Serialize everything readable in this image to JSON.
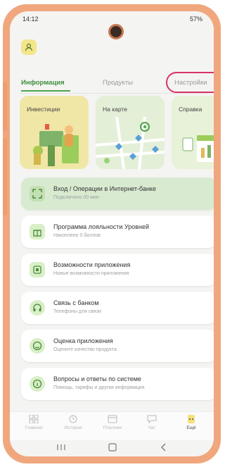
{
  "status_bar": {
    "time": "14:12",
    "right": "57%"
  },
  "tabs": [
    {
      "label": "Информация",
      "active": true
    },
    {
      "label": "Продукты",
      "active": false
    },
    {
      "label": "Настройки",
      "active": false
    }
  ],
  "cards": [
    {
      "title": "Инвестиции",
      "color": "#f0e6a6"
    },
    {
      "title": "На карте",
      "color": "#e4efd8"
    },
    {
      "title": "Справка",
      "color": "#e7f2d9"
    }
  ],
  "list_items": [
    {
      "title": "Вход / Операции в Интернет-банке",
      "subtitle": "Подключено 00 мин",
      "icon": "qr-icon",
      "active": true
    },
    {
      "title": "Программа лояльности Уровней",
      "subtitle": "Накоплено 0 баллов",
      "icon": "gift-icon",
      "active": false
    },
    {
      "title": "Возможности приложения",
      "subtitle": "Новые возможности приложения",
      "icon": "app-icon",
      "active": false
    },
    {
      "title": "Связь с банком",
      "subtitle": "Телефоны для связи",
      "icon": "headset-icon",
      "active": false
    },
    {
      "title": "Оценка приложения",
      "subtitle": "Оцените качество продукта",
      "icon": "smile-icon",
      "active": false
    },
    {
      "title": "Вопросы и ответы по системе",
      "subtitle": "Помощь, тарифы и другая информация",
      "icon": "info-icon",
      "active": false
    }
  ],
  "bottom_nav": [
    {
      "label": "Главная",
      "icon": "grid-icon"
    },
    {
      "label": "История",
      "icon": "clock-icon"
    },
    {
      "label": "Платежи",
      "icon": "card-icon"
    },
    {
      "label": "Чат",
      "icon": "chat-icon"
    },
    {
      "label": "Ещё",
      "icon": "more-icon"
    }
  ],
  "colors": {
    "accent": "#4ea34e",
    "frame": "#f0a77d",
    "highlight": "#d8336a"
  }
}
